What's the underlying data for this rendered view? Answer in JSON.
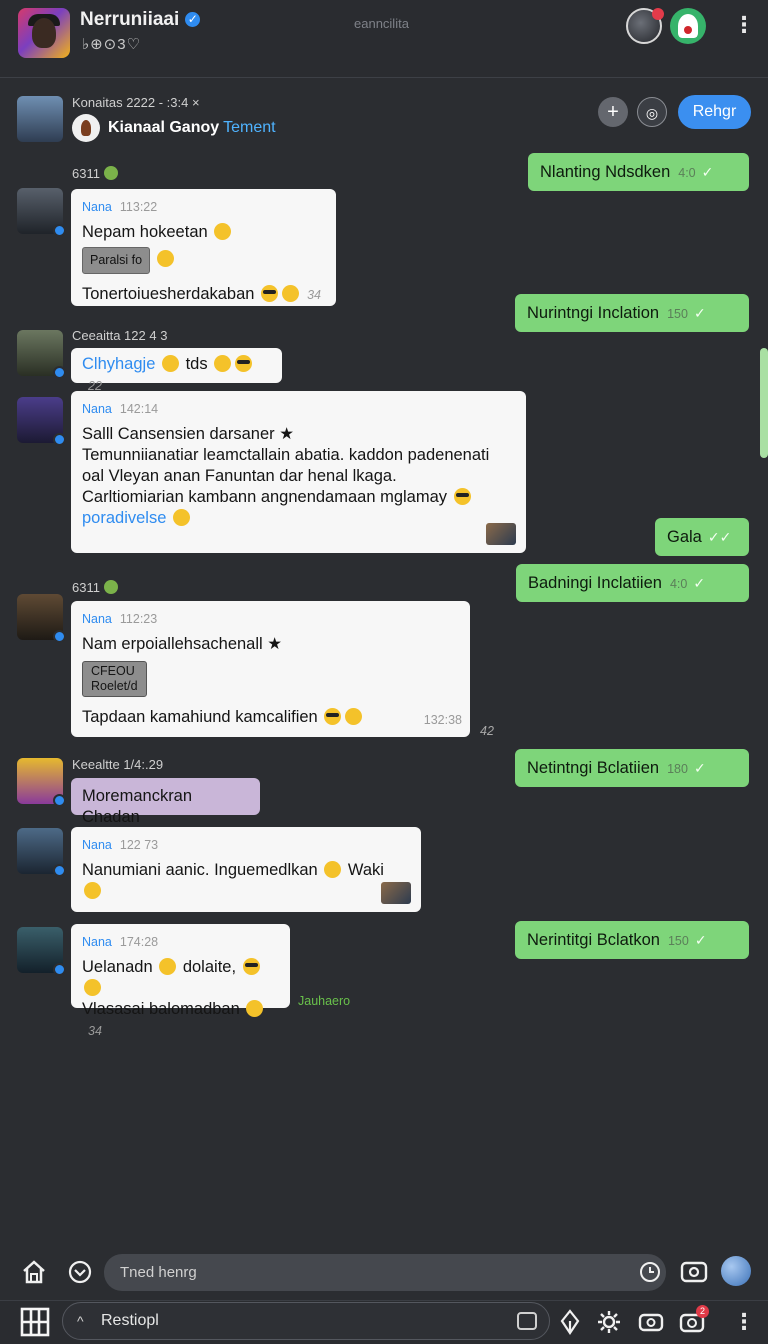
{
  "header": {
    "title": "Nerruniiaai",
    "subtitle": "♭⊕⊙3♡",
    "center_text": "eanncilita"
  },
  "group": {
    "meta": "Konaitas  2222 - :3:4 ×",
    "name": "Kianaal Ganoy",
    "name_accent": "Tement",
    "reply_label": "Rehgr"
  },
  "messages": {
    "date1": "6311",
    "date2": "6311",
    "m1": {
      "sender": "Nana",
      "time": "113:22",
      "line1": "Nepam hokeetan",
      "tag": "Paralsi fo",
      "line2": "Tonertoiuesherdakaban",
      "stamp": "34"
    },
    "m2": {
      "sender": "Ceeaitta",
      "time": "122 4 3",
      "link": "Clhyhagje",
      "text": "tds",
      "stamp": "22"
    },
    "m3": {
      "sender": "Nana",
      "time": "142:14",
      "title": "Salll Cansensien darsaner ★",
      "line1": "Temunniianatiar leamctallain abatia. kaddon padenenati",
      "line2": "oal Vleyan anan Fanuntan dar henal lkaga.",
      "line3": "Carltiomiarian kambann angnendamaan mglamay",
      "link": "poradivelse"
    },
    "m4": {
      "sender": "Nana",
      "time": "112:23",
      "title": "Nam erpoiallehsachenall ★",
      "tag1": "CFEOU",
      "tag2": "Roelet/d",
      "line": "Tapdaan kamahiund kamcalifien",
      "time2": "132:38",
      "stray": "42"
    },
    "m5": {
      "sender": "Keealtte",
      "time": "1/4:.29",
      "text": "Moremanckran Chadan"
    },
    "m6": {
      "sender": "Nana",
      "time": "122 73",
      "line": "Nanumiani aanic. Inguemedlkan",
      "tail": "Waki"
    },
    "m7": {
      "sender": "Nana",
      "time": "174:28",
      "line1": "Uelanadn",
      "line1b": "dolaite,",
      "line2": "Vlasasai balomadban",
      "stamp": "34",
      "trailing": "Jauhaero"
    }
  },
  "outgoing": [
    {
      "text": "Nlanting Ndsdken",
      "time": "4:0"
    },
    {
      "text": "Nurintngi Inclation",
      "time": "150"
    },
    {
      "text": "Gala",
      "time": ""
    },
    {
      "text": "Badningi Inclatiien",
      "time": "4:0"
    },
    {
      "text": "Netintngi Bclatiien",
      "time": "180"
    },
    {
      "text": "Nerintitgi Bclatkon",
      "time": "150"
    }
  ],
  "compose": {
    "placeholder": "Tned henrg"
  },
  "bottom": {
    "search_text": "Restiopl",
    "badge_count": "2"
  },
  "colors": {
    "accent": "#3b8ff0",
    "outgoing": "#7ed57a",
    "background": "#2b2d31",
    "incoming": "#f7f7f7"
  },
  "icons": [
    "verified-icon",
    "plus-icon",
    "camera-icon",
    "kebab-icon",
    "home-icon",
    "chevron-down-icon",
    "clock-icon",
    "photo-icon",
    "globe-icon",
    "grid-icon",
    "sticker-icon",
    "pin-icon",
    "settings-icon",
    "video-icon",
    "notification-icon"
  ]
}
